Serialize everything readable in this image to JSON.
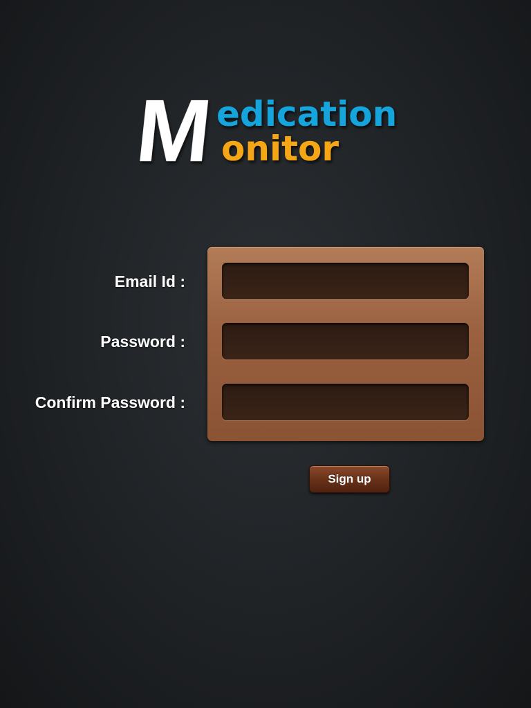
{
  "app": {
    "logo": {
      "big_letter": "M",
      "line1_rest": "edication",
      "line2_rest": "onitor",
      "colors": {
        "big_letter": "#ffffff",
        "line1": "#14a4dc",
        "line2": "#f5a612"
      }
    }
  },
  "form": {
    "email_label": "Email Id :",
    "password_label": "Password :",
    "confirm_label": "Confirm Password :",
    "email_value": "",
    "password_value": "",
    "confirm_value": ""
  },
  "actions": {
    "signup_label": "Sign up"
  }
}
